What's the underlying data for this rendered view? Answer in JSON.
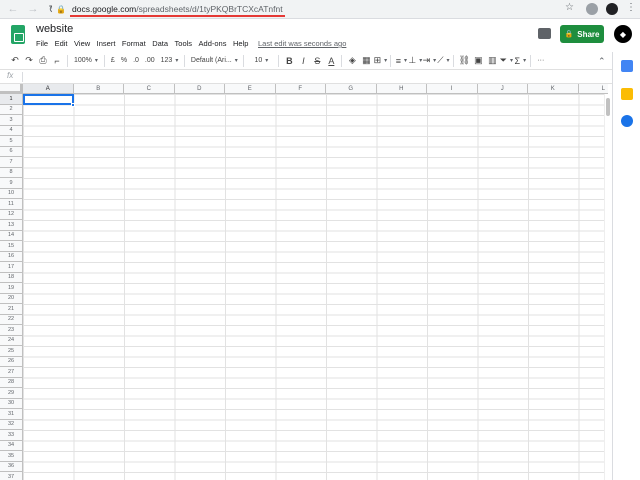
{
  "browser": {
    "url_host": "docs.google.com",
    "url_path": "/spreadsheets/d/1tyPKQBrTCXcATnfnt"
  },
  "doc": {
    "title": "website",
    "menu": [
      "File",
      "Edit",
      "View",
      "Insert",
      "Format",
      "Data",
      "Tools",
      "Add-ons",
      "Help"
    ],
    "last_edit": "Last edit was seconds ago",
    "share_label": "Share"
  },
  "toolbar": {
    "zoom": "100%",
    "currency": "£",
    "percent": "%",
    "decrease_decimal": ".0",
    "increase_decimal": ".00",
    "more_formats": "123",
    "font": "Default (Ari...",
    "font_size": "10",
    "bold": "B",
    "italic": "I",
    "strikethrough": "S",
    "text_color": "A",
    "more": "···"
  },
  "formula_bar": {
    "fx_label": "fx",
    "value": ""
  },
  "grid": {
    "columns": [
      "A",
      "B",
      "C",
      "D",
      "E",
      "F",
      "G",
      "H",
      "I",
      "J",
      "K",
      "L"
    ],
    "rows": [
      "1",
      "2",
      "3",
      "4",
      "5",
      "6",
      "7",
      "8",
      "9",
      "10",
      "11",
      "12",
      "13",
      "14",
      "15",
      "16",
      "17",
      "18",
      "19",
      "20",
      "21",
      "22",
      "23",
      "24",
      "25",
      "26",
      "27",
      "28",
      "29",
      "30",
      "31",
      "32",
      "33",
      "34",
      "35",
      "36",
      "37"
    ],
    "active_cell": "A1"
  },
  "colors": {
    "share_green": "#1e8e3e",
    "selection_blue": "#1a73e8",
    "sheets_green": "#23a566",
    "url_underline": "#e53935"
  }
}
